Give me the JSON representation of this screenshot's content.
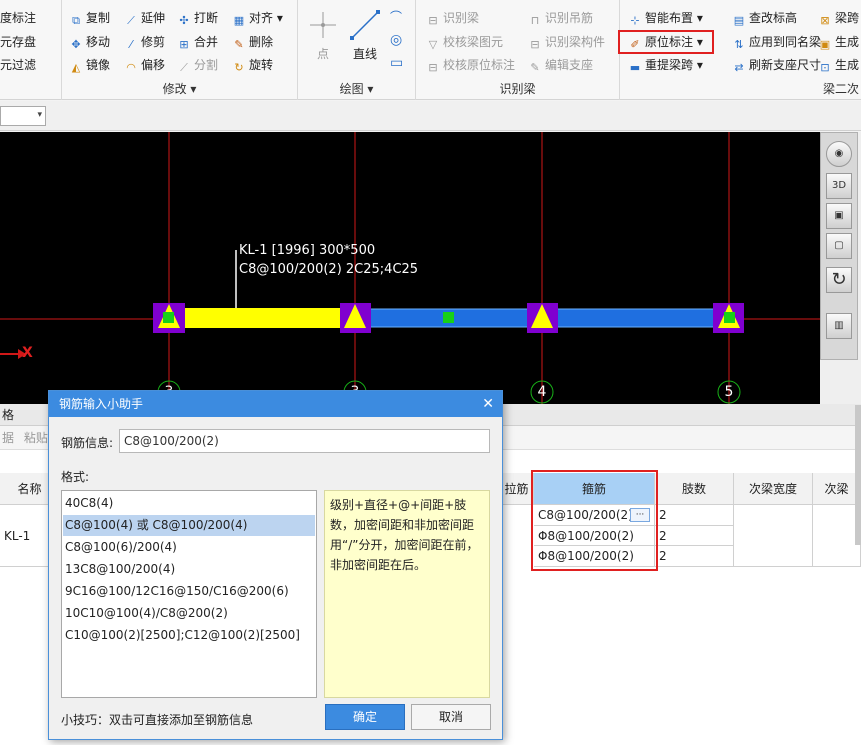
{
  "ribbon": {
    "group1": {
      "items": [
        "度标注",
        "元存盘",
        "元过滤"
      ]
    },
    "modify": {
      "title": "修改",
      "items": [
        {
          "label": "复制",
          "icon": "copy-icon"
        },
        {
          "label": "延伸",
          "icon": "extend-icon"
        },
        {
          "label": "打断",
          "icon": "break-icon"
        },
        {
          "label": "对齐",
          "icon": "align-icon"
        },
        {
          "label": "移动",
          "icon": "move-icon"
        },
        {
          "label": "修剪",
          "icon": "trim-icon"
        },
        {
          "label": "合并",
          "icon": "merge-icon"
        },
        {
          "label": "删除",
          "icon": "delete-icon"
        },
        {
          "label": "镜像",
          "icon": "mirror-icon"
        },
        {
          "label": "偏移",
          "icon": "offset-icon"
        },
        {
          "label": "分割",
          "icon": "split-icon"
        },
        {
          "label": "旋转",
          "icon": "rotate-icon"
        }
      ]
    },
    "draw": {
      "title": "绘图",
      "point": "点",
      "line": "直线"
    },
    "identify": {
      "title": "识别梁",
      "items": [
        "识别梁",
        "识别吊筋",
        "校核梁图元",
        "识别梁构件",
        "校核原位标注",
        "编辑支座"
      ]
    },
    "beam2": {
      "title": "梁二次",
      "items": [
        "智能布置",
        "查改标高",
        "原位标注",
        "应用到同名梁",
        "重提梁跨",
        "刷新支座尺寸",
        "梁跨",
        "生成",
        "生成"
      ]
    }
  },
  "canvas": {
    "annotation_line1": "KL-1 [1996] 300*500",
    "annotation_line2": "C8@100/200(2) 2C25;4C25",
    "axis_x": "X",
    "axis_numbers": [
      "3",
      "3",
      "4",
      "5"
    ]
  },
  "bottom_panel": {
    "title": "格",
    "toolbar": [
      "据",
      "粘贴跨"
    ],
    "columns": [
      "名称",
      "拉筋",
      "箍筋",
      "肢数",
      "次梁宽度",
      "次梁"
    ],
    "row_name": "KL-1",
    "stirrup_values": [
      "C8@100/200(2)",
      "Φ8@100/200(2)",
      "Φ8@100/200(2)"
    ],
    "limb_values": [
      "2",
      "2",
      "2"
    ],
    "ellipsis": "···"
  },
  "dialog": {
    "title": "钢筋输入小助手",
    "info_label": "钢筋信息:",
    "info_value": "C8@100/200(2)",
    "format_label": "格式:",
    "formats": [
      "40C8(4)",
      "C8@100(4) 或 C8@100/200(4)",
      "C8@100(6)/200(4)",
      "13C8@100/200(4)",
      "9C16@100/12C16@150/C16@200(6)",
      "10C10@100(4)/C8@200(2)",
      "C10@100(2)[2500];C12@100(2)[2500]"
    ],
    "help_text": "级别+直径+@+间距+肢数，加密间距和非加密间距用“/”分开，加密间距在前，非加密间距在后。",
    "tip": "小技巧：双击可直接添加至钢筋信息",
    "ok": "确定",
    "cancel": "取消"
  },
  "colors": {
    "accent": "#3c8be0",
    "highlight": "#e02020",
    "beam_yellow": "#ffff00",
    "beam_blue": "#1f6fe0"
  }
}
